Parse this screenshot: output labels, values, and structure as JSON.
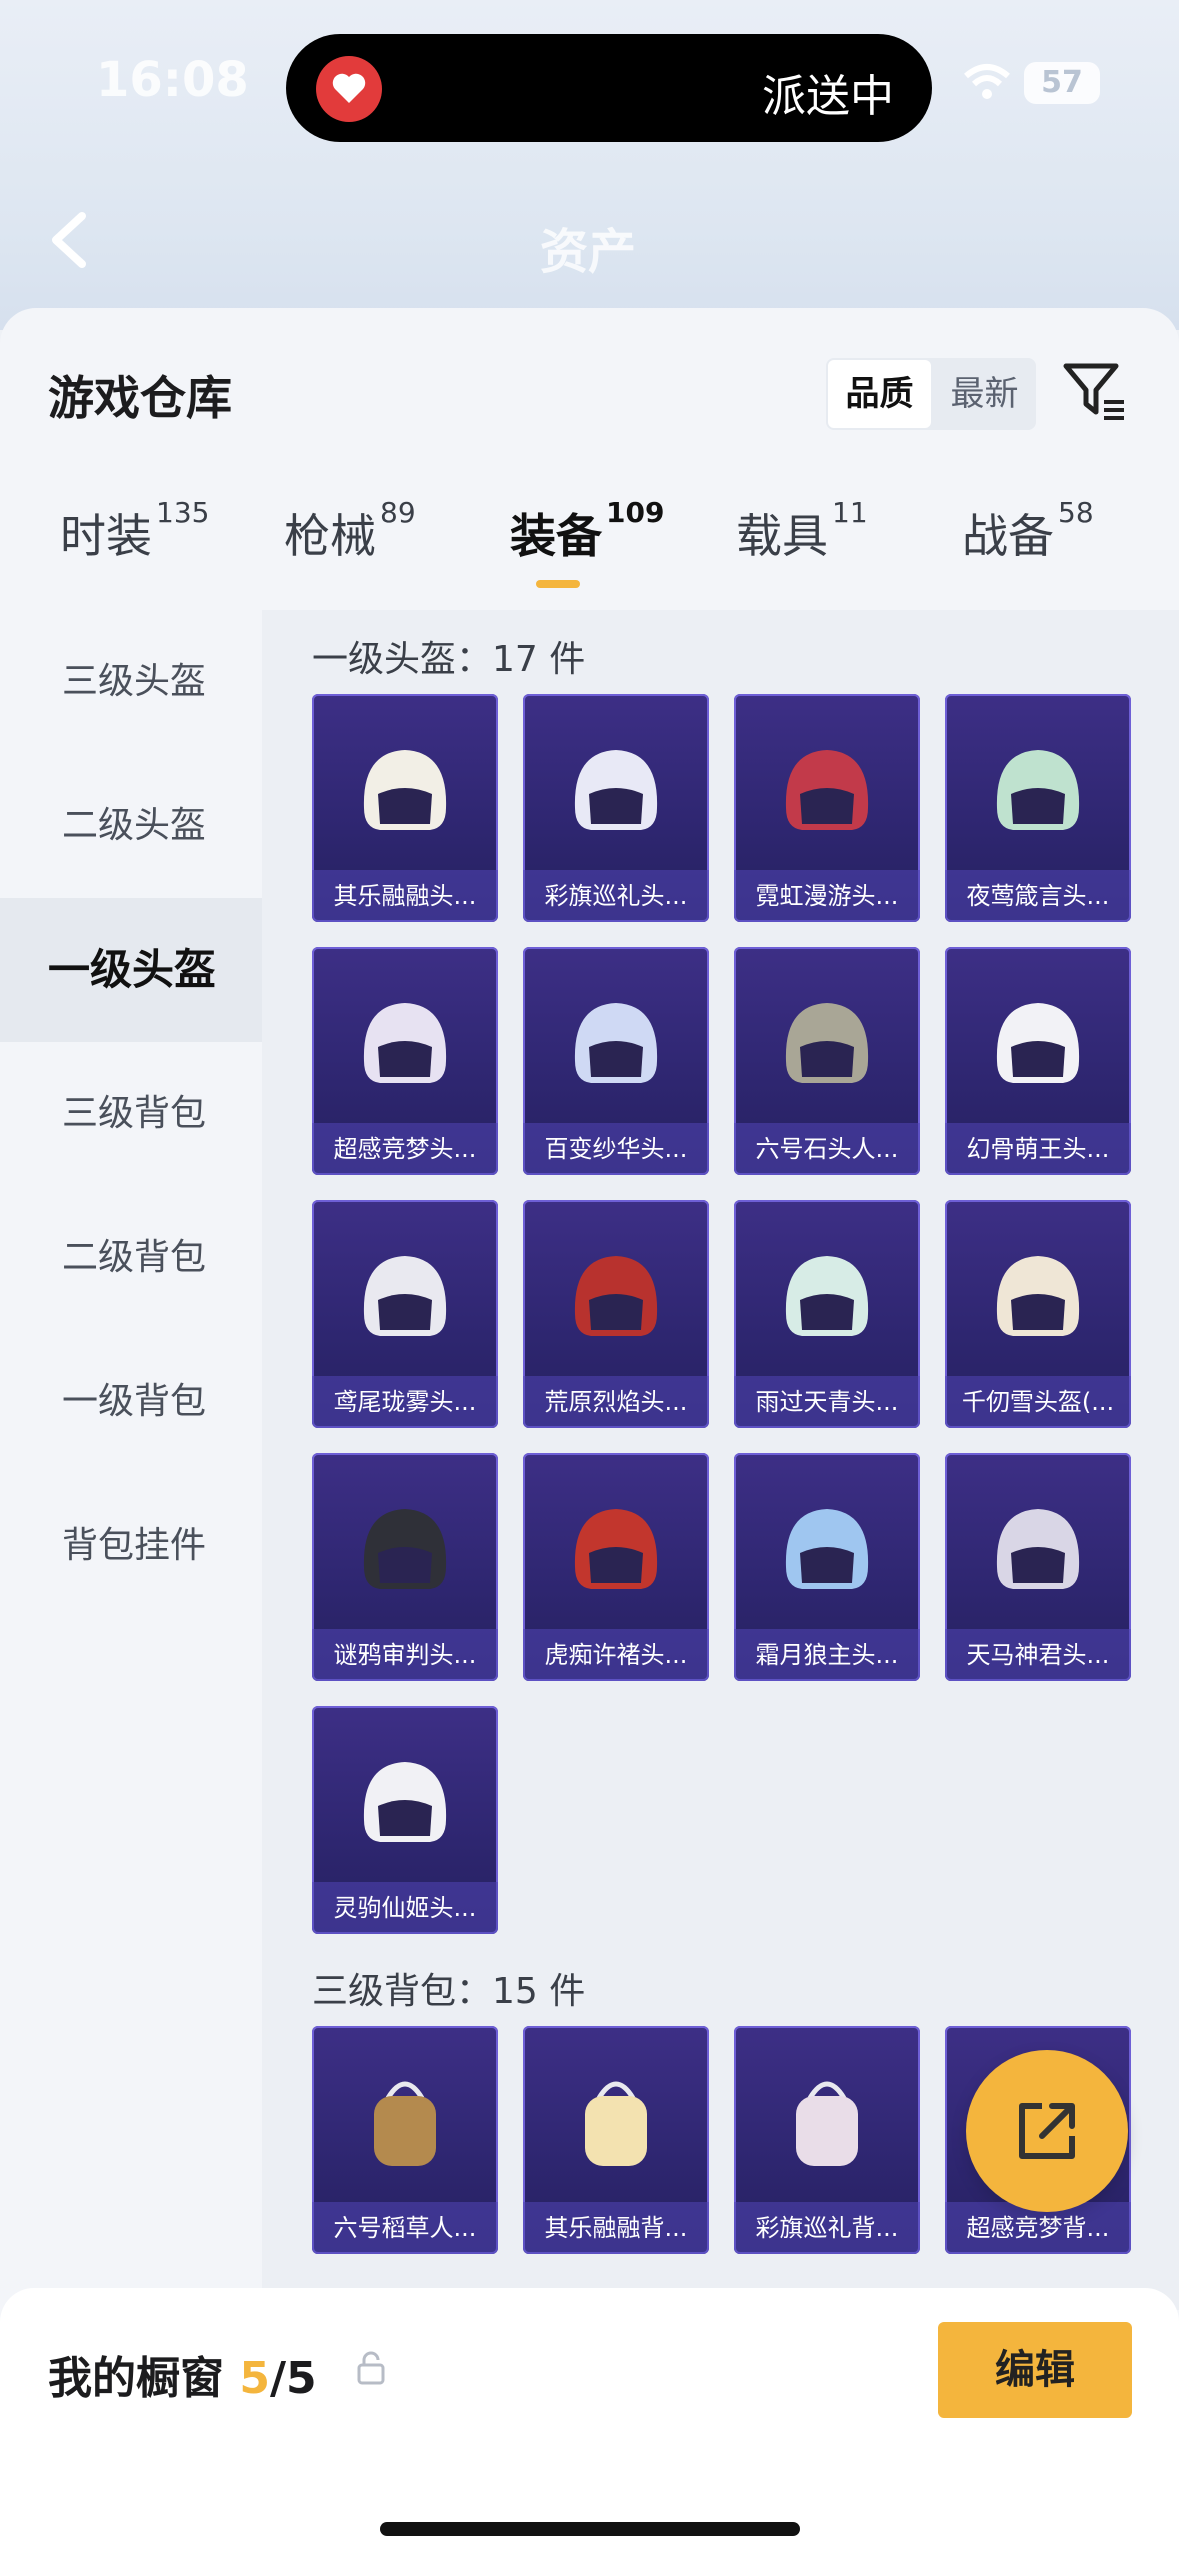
{
  "status": {
    "time": "16:08",
    "battery": "57",
    "island_text": "派送中"
  },
  "header": {
    "title": "资产"
  },
  "page": {
    "title": "游戏仓库"
  },
  "sort": {
    "options": [
      "品质",
      "最新"
    ],
    "active": "品质"
  },
  "tabs": [
    {
      "label": "时装",
      "count": "135"
    },
    {
      "label": "枪械",
      "count": "89"
    },
    {
      "label": "装备",
      "count": "109",
      "active": true
    },
    {
      "label": "载具",
      "count": "11"
    },
    {
      "label": "战备",
      "count": "58"
    }
  ],
  "sidebar": [
    {
      "label": "三级头盔"
    },
    {
      "label": "二级头盔"
    },
    {
      "label": "一级头盔",
      "active": true
    },
    {
      "label": "三级背包"
    },
    {
      "label": "二级背包"
    },
    {
      "label": "一级背包"
    },
    {
      "label": "背包挂件"
    }
  ],
  "sections": [
    {
      "title": "一级头盔：17 件",
      "items": [
        {
          "name": "其乐融融头...",
          "color": "#f2efe6"
        },
        {
          "name": "彩旗巡礼头...",
          "color": "#e8e9f6"
        },
        {
          "name": "霓虹漫游头...",
          "color": "#c23a4a"
        },
        {
          "name": "夜莺箴言头...",
          "color": "#bfe2cf"
        },
        {
          "name": "超感竞梦头...",
          "color": "#e7e2f2"
        },
        {
          "name": "百变纱华头...",
          "color": "#cfd9f4"
        },
        {
          "name": "六号石头人...",
          "color": "#a9a696"
        },
        {
          "name": "幻骨萌王头...",
          "color": "#f2f2f6"
        },
        {
          "name": "鸢尾珑雾头...",
          "color": "#e9e9f0"
        },
        {
          "name": "荒原烈焰头...",
          "color": "#b8322e"
        },
        {
          "name": "雨过天青头...",
          "color": "#d7ece6"
        },
        {
          "name": "千仞雪头盔(...",
          "color": "#efe6d6"
        },
        {
          "name": "谜鸦审判头...",
          "color": "#2f3038"
        },
        {
          "name": "虎痴许褚头...",
          "color": "#c2362d"
        },
        {
          "name": "霜月狼主头...",
          "color": "#9fc6f0"
        },
        {
          "name": "天马神君头...",
          "color": "#d9d6e6"
        },
        {
          "name": "灵驹仙姬头...",
          "color": "#f1f1f5"
        }
      ]
    },
    {
      "title": "三级背包：15 件",
      "items": [
        {
          "name": "六号稻草人...",
          "color": "#b48a4e"
        },
        {
          "name": "其乐融融背...",
          "color": "#f3e2b0"
        },
        {
          "name": "彩旗巡礼背...",
          "color": "#e9dde8"
        },
        {
          "name": "超感竞梦背...",
          "color": "#dcd6f0"
        }
      ]
    }
  ],
  "showcase": {
    "title": "我的橱窗",
    "current": "5",
    "total": "/5",
    "edit_label": "编辑"
  }
}
